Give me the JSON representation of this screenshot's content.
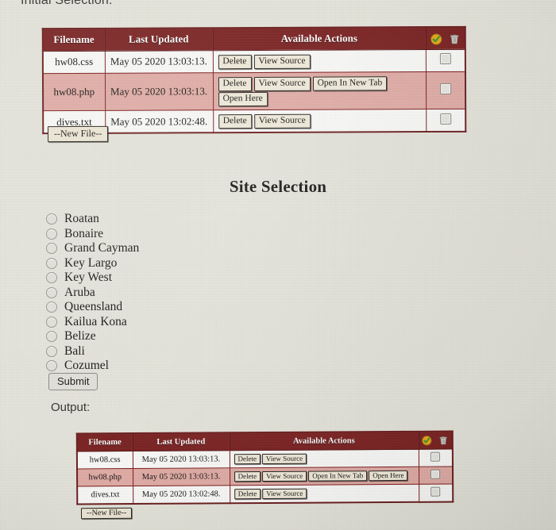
{
  "page": {
    "initial_selection_label": "Initial Selection:",
    "output_label": "Output:",
    "heading": "Site Selection"
  },
  "colors": {
    "page_background": "#e7e6dd",
    "table_header_bg": "#7d2020",
    "table_header_text": "#ffffff",
    "table_border": "#7d2020",
    "row_highlight_bg": "#e3aea8",
    "cell_bg": "#fbfbf9",
    "action_button_bg": "#f1ecdc",
    "check_icon": "#e8a81d",
    "check_mark": "#3f9a2e",
    "trash_icon": "#d8d6d0"
  },
  "file_table": {
    "columns": [
      "Filename",
      "Last Updated",
      "Available Actions"
    ],
    "header_icons": [
      "check-circle-icon",
      "trash-icon"
    ],
    "rows": [
      {
        "filename": "hw08.css",
        "last_updated": "May 05 2020 13:03:13.",
        "actions": [
          "Delete",
          "View Source"
        ],
        "highlighted": false,
        "checked": false
      },
      {
        "filename": "hw08.php",
        "last_updated": "May 05 2020 13:03:13.",
        "actions": [
          "Delete",
          "View Source",
          "Open In New Tab",
          "Open Here"
        ],
        "highlighted": true,
        "checked": false
      },
      {
        "filename": "dives.txt",
        "last_updated": "May 05 2020 13:02:48.",
        "actions": [
          "Delete",
          "View Source"
        ],
        "highlighted": false,
        "checked": false
      }
    ],
    "new_file_label": "--New File--"
  },
  "site_selection": {
    "heading": "Site Selection",
    "submit_label": "Submit",
    "selected": null,
    "options": [
      "Roatan",
      "Bonaire",
      "Grand Cayman",
      "Key Largo",
      "Key West",
      "Aruba",
      "Queensland",
      "Kailua Kona",
      "Belize",
      "Bali",
      "Cozumel"
    ]
  }
}
